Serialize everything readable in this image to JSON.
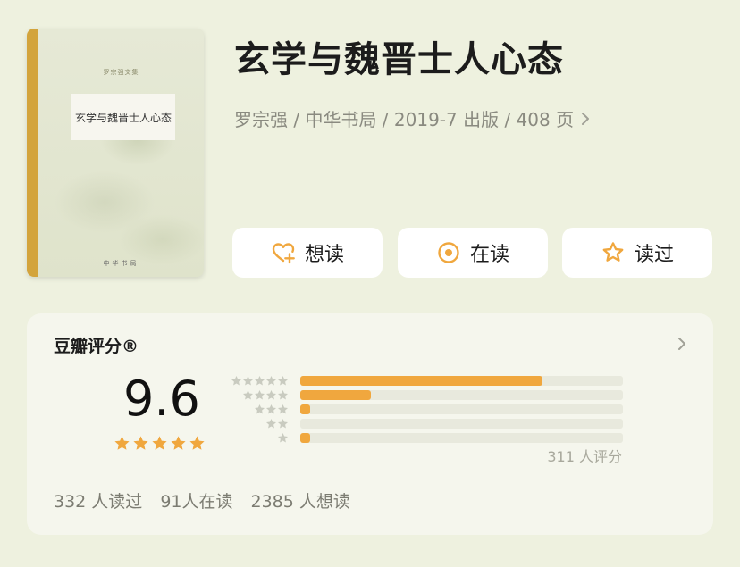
{
  "book": {
    "title": "玄学与魏晋士人心态",
    "meta": "罗宗强 / 中华书局 / 2019-7 出版 / 408 页",
    "cover": {
      "series": "罗宗强文集",
      "title": "玄学与魏晋士人心态",
      "publisher": "中华书局"
    }
  },
  "actions": {
    "want_label": "想读",
    "reading_label": "在读",
    "read_label": "读过"
  },
  "rating": {
    "heading": "豆瓣评分®",
    "score": "9.6",
    "stars": 5,
    "distribution": [
      {
        "stars": 5,
        "percent": 75
      },
      {
        "stars": 4,
        "percent": 22
      },
      {
        "stars": 3,
        "percent": 3
      },
      {
        "stars": 2,
        "percent": 0
      },
      {
        "stars": 1,
        "percent": 3
      }
    ],
    "count_text": "311 人评分",
    "stats": {
      "read": "332 人读过",
      "reading": "91人在读",
      "want": "2385 人想读"
    }
  },
  "colors": {
    "accent": "#f0a73e",
    "background": "#eef1df",
    "card": "#f5f6ed",
    "star_inactive": "#c9cbc0"
  },
  "icons": {
    "want": "heart-plus-icon",
    "reading": "circle-dot-icon",
    "read": "star-outline-icon",
    "chevron": "chevron-right-icon"
  }
}
